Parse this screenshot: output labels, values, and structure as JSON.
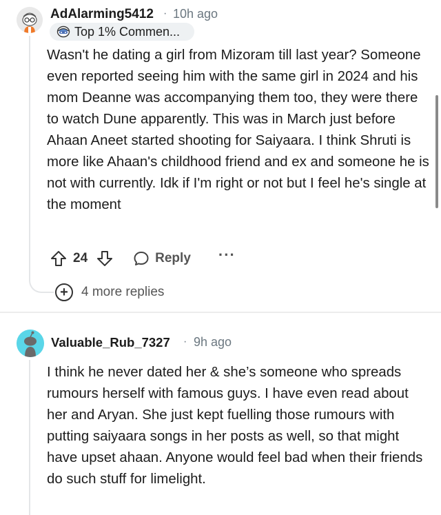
{
  "comments": [
    {
      "username": "AdAlarming5412",
      "dot": "·",
      "time": "10h ago",
      "flair": "Top 1% Commen...",
      "body": "Wasn't he dating a girl from Mizoram till last year? Someone even reported seeing him with the same girl in 2024 and his mom Deanne was accompanying them too, they were there to watch Dune apparently. This was in March just before Ahaan Aneet started shooting for Saiyaara. I think Shruti is more like Ahaan's childhood friend and ex and someone he is not with currently. Idk if I'm right or not but I feel he's single at the moment",
      "score": "24",
      "reply_label": "Reply",
      "more_label": "···",
      "more_replies": "4 more replies",
      "more_replies_symbol": "+"
    },
    {
      "username": "Valuable_Rub_7327",
      "dot": "·",
      "time": "9h ago",
      "body": "I think he never dated her & she’s someone who spreads rumours herself with famous guys. I have even read about her and Aryan. She just kept fuelling those rumours with putting saiyaara songs in her posts as well, so that might have upset ahaan. Anyone would feel bad when their friends do such stuff for limelight."
    }
  ],
  "colors": {
    "text": "#1c1c1c",
    "meta": "#6b7780",
    "badge_bg": "#eef1f3",
    "thread": "#e4e6e8",
    "avatar2_bg": "#5ad6e8"
  },
  "icons": {
    "avatar1": "snoo-avatar-icon",
    "avatar2": "snoo-avatar-icon",
    "flair": "top-commenter-icon",
    "upvote": "upvote-arrow-icon",
    "downvote": "downvote-arrow-icon",
    "reply": "speech-bubble-icon",
    "expand": "plus-circle-icon"
  }
}
